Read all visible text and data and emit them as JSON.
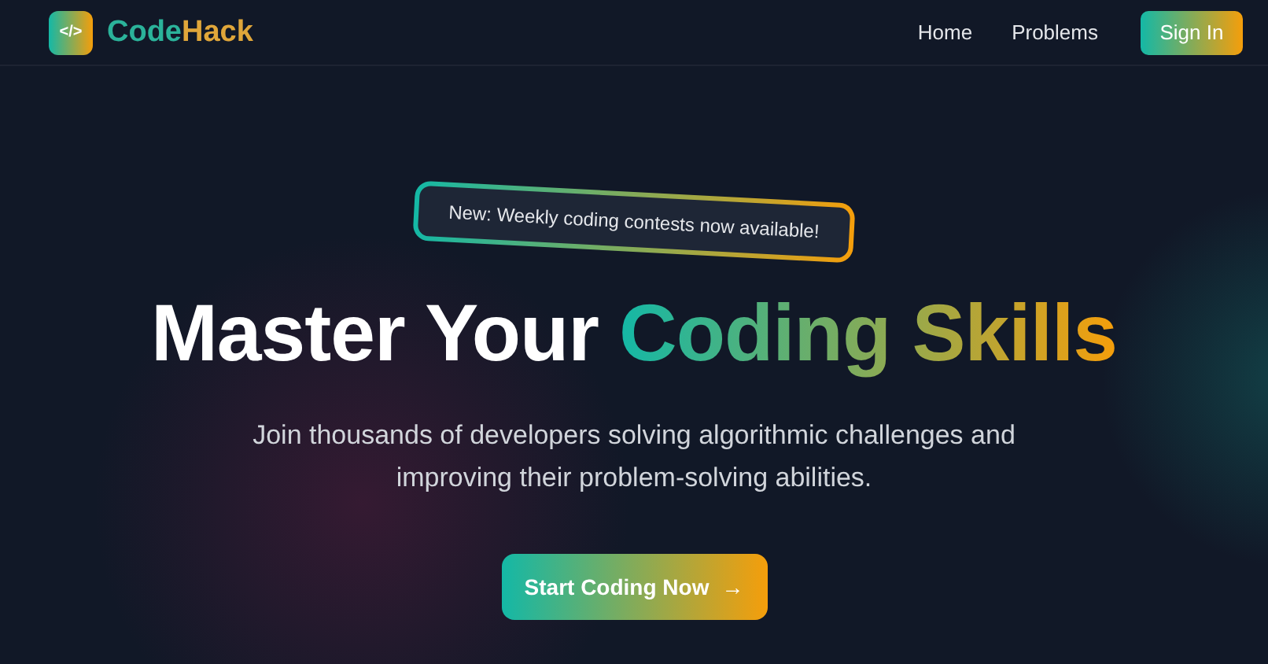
{
  "brand": {
    "name_first": "Code",
    "name_second": "Hack",
    "icon_text": "</>"
  },
  "nav": {
    "links": [
      {
        "label": "Home"
      },
      {
        "label": "Problems"
      }
    ],
    "sign_in": "Sign In"
  },
  "hero": {
    "badge": "New: Weekly coding contests now available!",
    "title_plain": "Master Your",
    "title_highlight": "Coding Skills",
    "subtitle": "Join thousands of developers solving algorithmic challenges and improving their problem-solving abilities.",
    "cta": {
      "label": "Start Coding Now",
      "arrow": "→"
    }
  }
}
